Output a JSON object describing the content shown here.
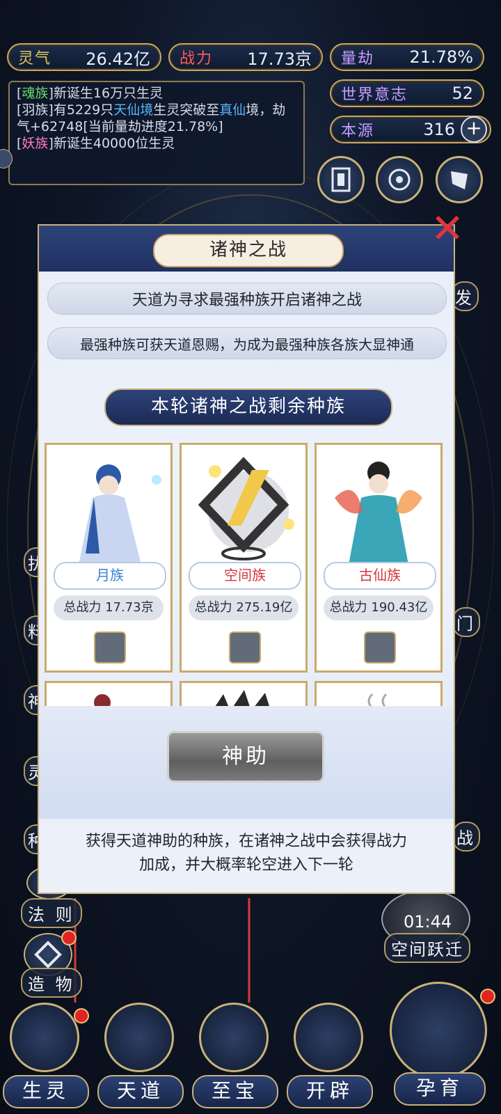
{
  "resources": {
    "lingqi": {
      "label": "灵气",
      "value": "26.42亿"
    },
    "zhanli": {
      "label": "战力",
      "value": "17.73京"
    },
    "liangjie": {
      "label": "量劫",
      "value": "21.78%"
    },
    "shijie": {
      "label": "世界意志",
      "value": "52"
    },
    "benyuan": {
      "label": "本源",
      "value": "316"
    }
  },
  "log": {
    "line1_tag": "魂族",
    "line1_text": "新诞生16万只生灵",
    "line2_pre": "[羽族]有5229只",
    "line2_blue1": "天仙境",
    "line2_mid": "生灵突破至",
    "line2_blue2": "真仙",
    "line2_cont": "境，劫气+62748[当前量劫进度21.78%]",
    "line3_tag": "妖族",
    "line3_text": "新诞生40000位生灵"
  },
  "side_labels": {
    "right_fa": "发",
    "right_men": "门",
    "right_zhan": "战",
    "left_zao": "扰",
    "left_liao": "料",
    "left_shen": "神",
    "left_ling": "灵",
    "left_zhong": "种",
    "faze": "法 则",
    "zaowu": "造 物",
    "kongjian": "空间跃迁",
    "timer": "01:44"
  },
  "modal": {
    "title": "诸神之战",
    "banner1": "天道为寻求最强种族开启诸神之战",
    "banner2": "最强种族可获天道恩赐，为成为最强种族各族大显神通",
    "section": "本轮诸神之战剩余种族",
    "cards": [
      {
        "name": "月族",
        "power": "总战力 17.73京",
        "name_color": "#3b82d6"
      },
      {
        "name": "空间族",
        "power": "总战力 275.19亿",
        "name_color": "#d6363c"
      },
      {
        "name": "古仙族",
        "power": "总战力 190.43亿",
        "name_color": "#d6363c"
      }
    ],
    "button": "神助",
    "footnote_line1": "获得天道神助的种族，在诸神之战中会获得战力",
    "footnote_line2": "加成，并大概率轮空进入下一轮"
  },
  "nav": [
    {
      "label": "生灵"
    },
    {
      "label": "天道"
    },
    {
      "label": "至宝"
    },
    {
      "label": "开辟"
    },
    {
      "label": "孕育"
    }
  ]
}
